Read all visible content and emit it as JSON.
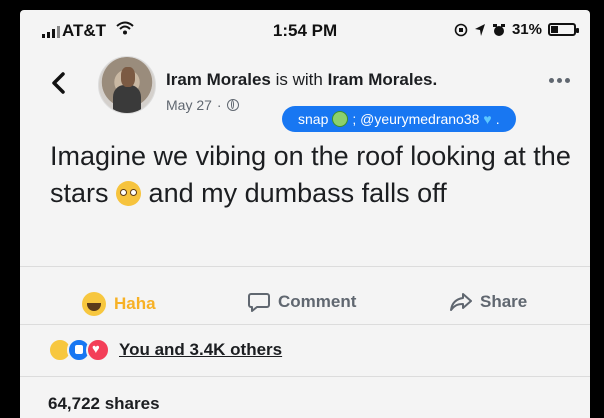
{
  "status_bar": {
    "carrier": "AT&T",
    "time": "1:54 PM",
    "battery": "31%",
    "battery_level": 0.31
  },
  "post": {
    "author_name": "Iram Morales",
    "with_text": "is with",
    "tagged_name": "Iram Morales.",
    "date": "May 27",
    "privacy_icon": "globe-icon",
    "snap_label": "snap",
    "snap_handle": "; @yeurymedrano38",
    "text_part1": "Imagine we vibing on the roof looking at the stars",
    "text_part2": "and my dumbass falls off"
  },
  "actions": {
    "haha": "Haha",
    "comment": "Comment",
    "share": "Share"
  },
  "reactions": {
    "text": "You and 3.4K others"
  },
  "shares": "64,722 shares",
  "colors": {
    "facebook_blue": "#1877f2",
    "haha_yellow": "#f7b125",
    "love_red": "#f33e58"
  }
}
